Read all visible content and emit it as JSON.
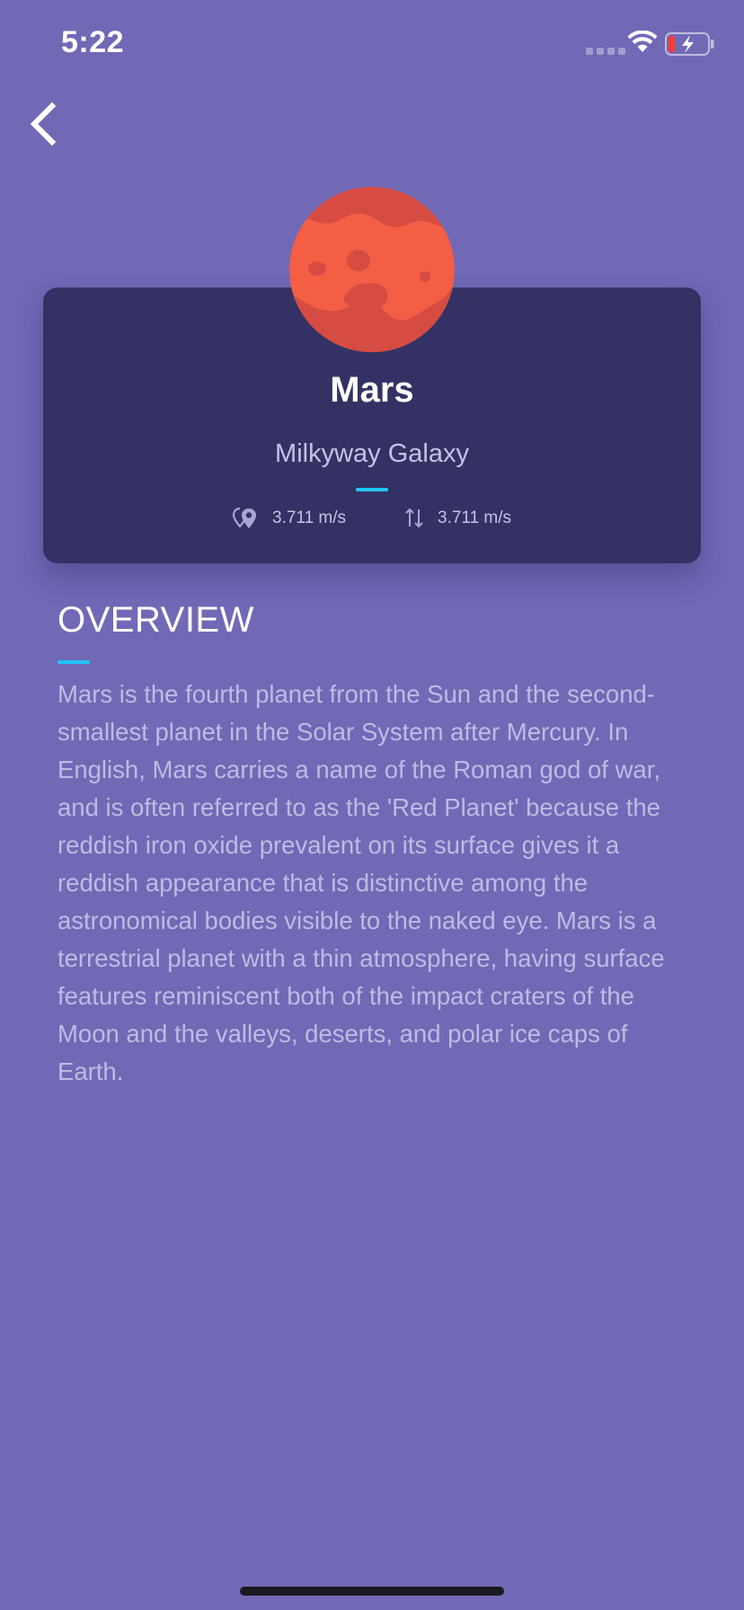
{
  "status_bar": {
    "time": "5:22"
  },
  "planet": {
    "name": "Mars",
    "galaxy": "Milkyway Galaxy",
    "stats": [
      {
        "icon": "location-pin-icon",
        "value": "3.711 m/s"
      },
      {
        "icon": "gravity-arrows-icon",
        "value": "3.711 m/s"
      }
    ]
  },
  "overview": {
    "title": "OVERVIEW",
    "text": "Mars is the fourth planet from the Sun and the second-smallest planet in the Solar System after Mercury. In English, Mars carries a name of the Roman god of war, and is often referred to as the 'Red Planet' because the reddish iron oxide prevalent on its surface gives it a reddish appearance that is distinctive among the astronomical bodies visible to the naked eye. Mars is a terrestrial planet with a thin atmosphere, having surface features reminiscent both of the impact craters of the Moon and the valleys, deserts, and polar ice caps of Earth."
  },
  "colors": {
    "background": "#7169b6",
    "card": "#343264",
    "accent": "#1fc6f5",
    "planet_surface": "#f35e44",
    "planet_shade": "#d64b42"
  }
}
